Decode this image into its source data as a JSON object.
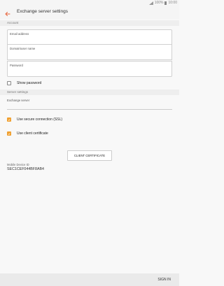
{
  "status_bar": {
    "battery_text": "100%",
    "time": "10:00"
  },
  "app_bar": {
    "title": "Exchange server settings",
    "back_icon": "arrow-left-icon",
    "accent": "#e8643c"
  },
  "account": {
    "section_label": "Account",
    "email_placeholder": "Email address",
    "domain_placeholder": "Domain\\user name",
    "password_placeholder": "Password",
    "show_password_label": "Show password",
    "show_password_checked": false
  },
  "server_settings": {
    "section_label": "Server settings",
    "exchange_server_label": "Exchange server",
    "ssl_label": "Use secure connection (SSL)",
    "ssl_checked": true,
    "client_cert_label": "Use client certificate",
    "client_cert_checked": true,
    "client_certificate_button": "CLIENT CERTIFICATE",
    "checkbox_color": "#f0a030"
  },
  "device": {
    "mobile_id_label": "Mobile Device ID",
    "mobile_id_value": "SEC1CEF044BF8AB4"
  },
  "footer": {
    "sign_in_label": "SIGN IN"
  }
}
